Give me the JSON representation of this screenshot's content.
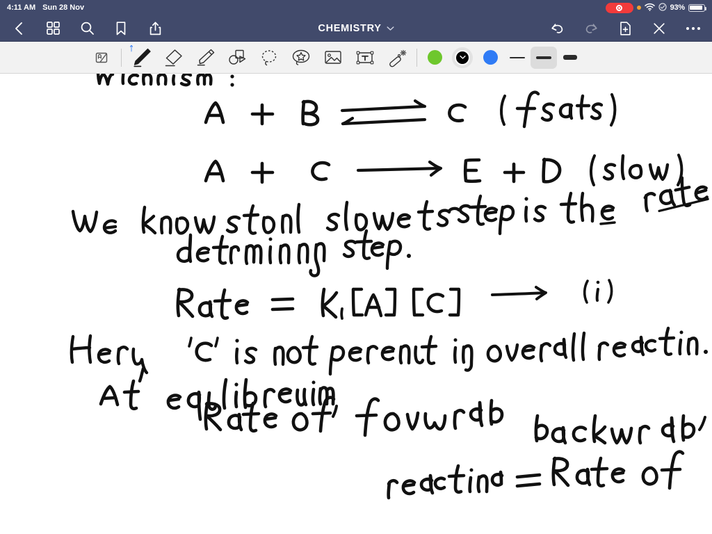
{
  "status_bar": {
    "time": "4:11 AM",
    "date": "Sun 28 Nov",
    "battery_percent": "93%",
    "battery_level": 93,
    "recording_indicator": "screen-recording-active",
    "icons": [
      "record-pill-icon",
      "orange-dot-icon",
      "wifi-icon",
      "control-center-icon",
      "battery-icon"
    ],
    "colors": {
      "bar_bg": "#414a6b",
      "record_red": "#f23b3b",
      "orange": "#f0a030"
    }
  },
  "nav_bar": {
    "title": "CHEMISTRY",
    "title_chevron": "chevron-down-icon",
    "left_icons": [
      "back-chevron-icon",
      "grid-view-icon",
      "search-icon",
      "bookmark-icon",
      "share-icon"
    ],
    "right_icons": [
      "undo-icon",
      "redo-icon",
      "add-page-icon",
      "close-icon",
      "more-options-icon"
    ],
    "redo_disabled": true
  },
  "tool_bar": {
    "tools": [
      {
        "name": "palm-rejection-icon",
        "label": "Palm Rejection",
        "active": false
      },
      {
        "name": "pen-icon",
        "label": "Pen",
        "active": true,
        "bluetooth": true
      },
      {
        "name": "eraser-icon",
        "label": "Eraser",
        "active": false
      },
      {
        "name": "highlighter-icon",
        "label": "Highlighter",
        "active": false
      },
      {
        "name": "shapes-icon",
        "label": "Shapes",
        "active": false
      },
      {
        "name": "lasso-icon",
        "label": "Lasso Select",
        "active": false
      },
      {
        "name": "sticker-icon",
        "label": "Sticker",
        "active": false
      },
      {
        "name": "image-icon",
        "label": "Image",
        "active": false
      },
      {
        "name": "text-box-icon",
        "label": "Text Box",
        "active": false
      },
      {
        "name": "magic-wand-icon",
        "label": "Magic Wand",
        "active": false
      }
    ],
    "colors": [
      {
        "name": "green-swatch",
        "hex": "#6ec72d",
        "selected": false
      },
      {
        "name": "black-swatch",
        "hex": "#000000",
        "selected": true
      },
      {
        "name": "blue-swatch",
        "hex": "#2f7bf5",
        "selected": false
      }
    ],
    "stroke_widths": [
      {
        "name": "thin-stroke",
        "px": 2,
        "selected": false
      },
      {
        "name": "medium-stroke",
        "px": 4,
        "selected": true
      },
      {
        "name": "thick-stroke",
        "px": 7,
        "selected": false
      }
    ],
    "bar_bg": "#f2f2f2"
  },
  "note": {
    "ink_color": "#111111",
    "lines": [
      {
        "id": "heading",
        "text": "Mechanism :",
        "clipped_top": true
      },
      {
        "id": "eq1",
        "text": "A + B ⇌ C ( fast)"
      },
      {
        "id": "eq2",
        "text": "A + C ⟶ E + D (slow)"
      },
      {
        "id": "stmt1a",
        "text": "We know that slowest step is the rate"
      },
      {
        "id": "stmt1b",
        "text": "determining step."
      },
      {
        "id": "eq3",
        "text": "Rate = K₁ [A] [C] ⟶ (i)"
      },
      {
        "id": "stmt2",
        "text": "Here , 'C' is not present in overall reaction."
      },
      {
        "id": "stmt3a",
        "text": "At equilibrium,"
      },
      {
        "id": "stmt3b",
        "text": "Rate of forward reaction = Rate of"
      },
      {
        "id": "stmt3c",
        "text": "backward ,"
      }
    ]
  }
}
